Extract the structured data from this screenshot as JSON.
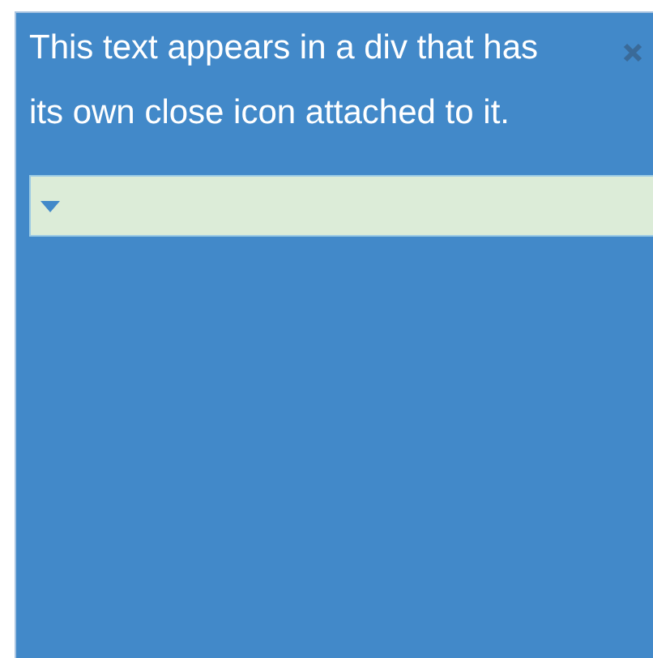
{
  "panel": {
    "message": "This text appears in a div that has its own close icon attached to it.",
    "dropdown": {
      "expanded": false
    }
  }
}
